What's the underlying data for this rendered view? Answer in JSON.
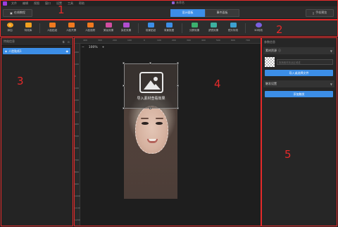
{
  "menubar": {
    "items": [
      "文件",
      "编辑",
      "视图",
      "窗口",
      "设置",
      "工具",
      "帮助"
    ],
    "title": "未命名"
  },
  "topbar": {
    "tutorial_label": "在线教程",
    "tabs": [
      {
        "label": "设计面板",
        "active": true
      },
      {
        "label": "事件面板",
        "active": false
      }
    ],
    "preview_label": "手机预览"
  },
  "toolbar": {
    "tools": [
      {
        "label": "添加",
        "icon": "add-icon",
        "color": "#f0a020"
      },
      {
        "label": "特效库",
        "icon": "library-icon",
        "color": "#f0a020"
      },
      {
        "label": "人脸贴纸",
        "icon": "face-sticker-icon",
        "color": "#f07a20"
      },
      {
        "label": "人脸开屏",
        "icon": "face-screen-icon",
        "color": "#f07a20"
      },
      {
        "label": "人脸追踪",
        "icon": "face-track-icon",
        "color": "#f07a20"
      },
      {
        "label": "美妆效果",
        "icon": "makeup-icon",
        "color": "#d04ea0"
      },
      {
        "label": "染发效果",
        "icon": "hair-dye-icon",
        "color": "#b04ed0"
      },
      {
        "label": "前景贴纸",
        "icon": "foreground-icon",
        "color": "#3c8ee7"
      },
      {
        "label": "背景抠图",
        "icon": "background-icon",
        "color": "#3c8ee7"
      },
      {
        "label": "分屏效果",
        "icon": "split-screen-icon",
        "color": "#3cb06e"
      },
      {
        "label": "滤镜效果",
        "icon": "filter-icon",
        "color": "#3cb0a0"
      },
      {
        "label": "镜头特效",
        "icon": "lens-icon",
        "color": "#3ca0d0"
      },
      {
        "label": "3D特效",
        "icon": "3d-icon",
        "color": "#7a5fe0"
      }
    ]
  },
  "left_panel": {
    "title": "特效信息",
    "layer_label": "人脸贴纸1"
  },
  "canvas": {
    "zoom_minus": "−",
    "zoom_value": "100%",
    "zoom_plus": "+",
    "ruler_top": [
      "400",
      "300",
      "200",
      "100",
      "0",
      "100",
      "200",
      "300",
      "400",
      "500",
      "600",
      "700"
    ],
    "ruler_left": [
      "200",
      "100",
      "0",
      "100",
      "200",
      "300",
      "400",
      "500",
      "600",
      "700",
      "800",
      "900",
      "1000",
      "1100",
      "1200"
    ],
    "overlay_text": "导入素材查看效果"
  },
  "right_panel": {
    "title": "参数信息",
    "material_section": "素材资源",
    "material_hint": "拖拽素材到此区域或",
    "import_button": "导入或选择文件",
    "trigger_section": "触发设置",
    "add_trigger_button": "添加触发"
  },
  "annotations": [
    "1",
    "2",
    "3",
    "4",
    "5"
  ]
}
